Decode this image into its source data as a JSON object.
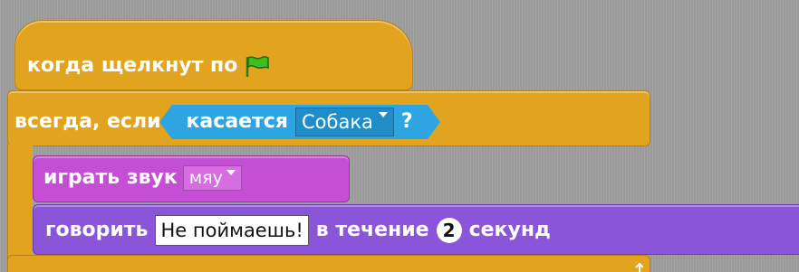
{
  "script": {
    "hat_block": {
      "label": "когда щелкнут по",
      "icon": "green-flag-icon",
      "color": "#e2a31f"
    },
    "control_block": {
      "label": "всегда, если",
      "color": "#e2a31f",
      "condition": {
        "label": "касается",
        "dropdown_value": "Собака",
        "suffix": "?",
        "color": "#2ca5e2"
      }
    },
    "sound_block": {
      "label": "играть звук",
      "dropdown_value": "мяу",
      "color": "#c44fd4"
    },
    "looks_block": {
      "label": "говорить",
      "text_value": "Не поймаешь!",
      "middle_label": "в течение",
      "number_value": "2",
      "suffix_label": "секунд",
      "color": "#8a55d8"
    },
    "loop_icon": "loop-arrow-icon"
  }
}
